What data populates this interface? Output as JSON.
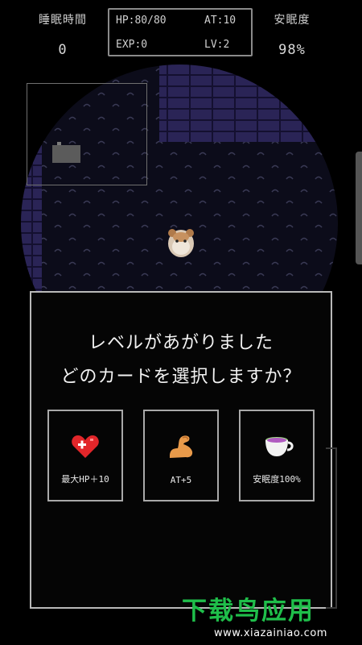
{
  "hud": {
    "sleep_time_label": "睡眠時間",
    "sleep_time_value": "0",
    "hp": "HP:80/80",
    "at": "AT:10",
    "exp": "EXP:0",
    "lv": "LV:2",
    "rest_label": "安眠度",
    "rest_value": "98%"
  },
  "dialog": {
    "line1": "レベルがあがりました",
    "line2": "どのカードを選択しますか？",
    "cards": [
      {
        "label": "最大HP＋10",
        "icon": "heart-plus-icon",
        "color": "#e2262a"
      },
      {
        "label": "AT+5",
        "icon": "flexed-arm-icon",
        "color": "#e89a4a"
      },
      {
        "label": "安眠度100%",
        "icon": "teacup-icon",
        "color": "#a3d98a"
      }
    ]
  },
  "watermark": {
    "title": "下载鸟应用",
    "url": "www.xiazainiao.com"
  },
  "colors": {
    "floor": "#0c0c1a",
    "wall": "#2a2456",
    "wall_mortar": "#141030",
    "watermark_green": "#1fbe4a"
  }
}
